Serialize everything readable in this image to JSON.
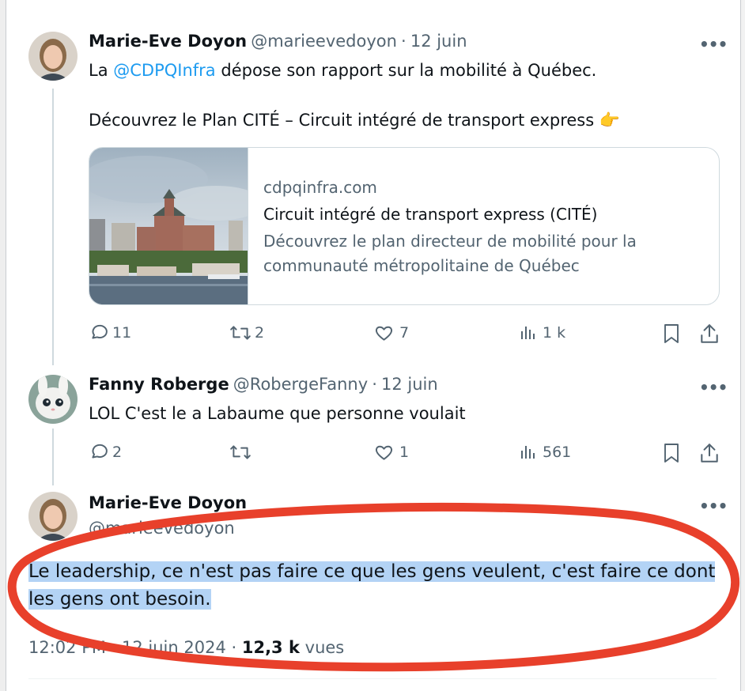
{
  "tweet1": {
    "name": "Marie-Eve Doyon",
    "handle": "@marieevedoyon",
    "dot": "·",
    "date": "12 juin",
    "text_prefix": "La ",
    "mention": "@CDPQInfra",
    "text_suffix": " dépose son rapport sur la mobilité à Québec.",
    "text_line2": "Découvrez le Plan CITÉ – Circuit intégré de transport express ",
    "emoji": "👉",
    "card": {
      "domain": "cdpqinfra.com",
      "title": "Circuit intégré de transport express (CITÉ)",
      "description_line1": "Découvrez le plan directeur de mobilité pour la",
      "description_line2": "communauté métropolitaine de Québec"
    },
    "replies": "11",
    "reposts": "2",
    "likes": "7",
    "views": "1 k"
  },
  "tweet2": {
    "name": "Fanny Roberge",
    "handle": "@RobergeFanny",
    "dot": "·",
    "date": "12 juin",
    "text": "LOL C'est le a Labaume que personne voulait",
    "replies": "2",
    "reposts": "",
    "likes": "1",
    "views": "561"
  },
  "tweet3": {
    "name": "Marie-Eve Doyon",
    "handle": "@marieevedoyon",
    "text_line1": "Le leadership, ce n'est pas faire ce que les gens veulent, c'est faire ce dont",
    "text_line2": "les gens ont besoin.",
    "time": "12:02 PM · 12 juin 2024",
    "views_count": "12,3 k",
    "views_label": "vues"
  },
  "more_label": "•••",
  "colors": {
    "link": "#1d9bf0",
    "secondary": "#536471",
    "highlight": "#b3d3f5",
    "annotation": "#e8402b"
  },
  "icons": [
    "reply-icon",
    "repost-icon",
    "like-icon",
    "views-icon",
    "bookmark-icon",
    "share-icon",
    "more-icon"
  ]
}
